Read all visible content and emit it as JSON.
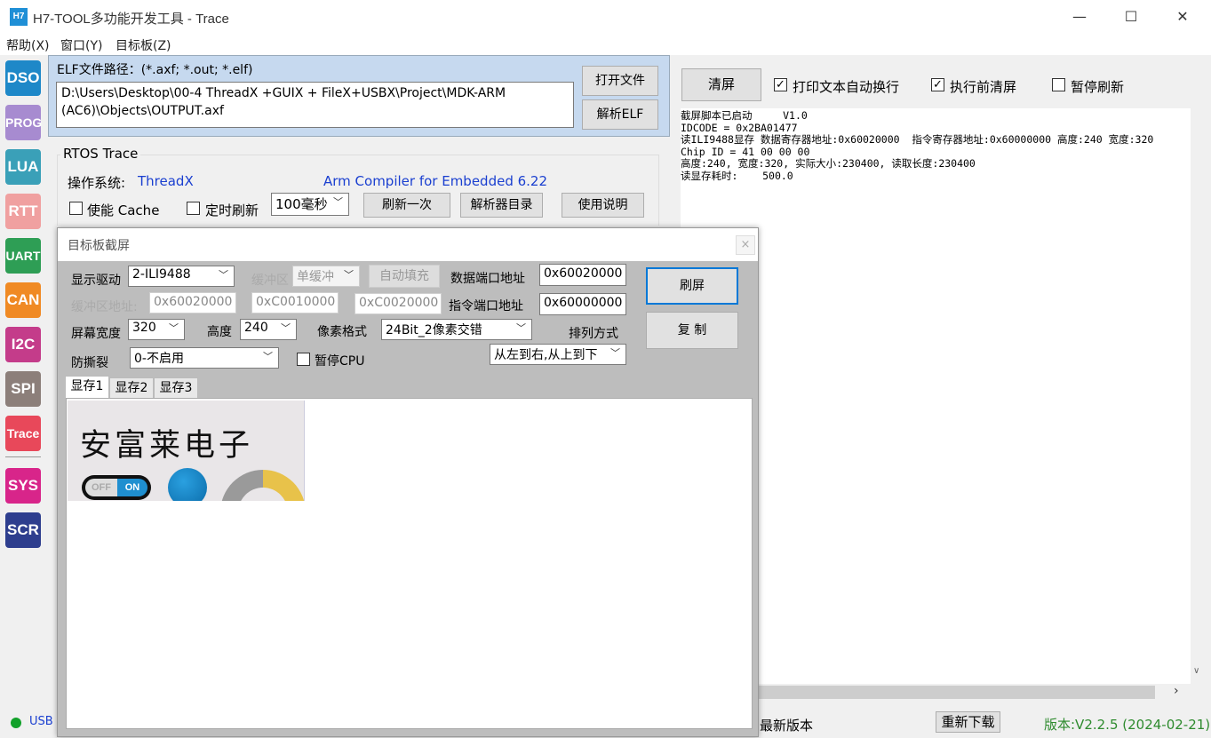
{
  "window": {
    "icon_text": "H7",
    "title": "H7-TOOL多功能开发工具 - Trace",
    "minimize": "—",
    "maximize": "☐",
    "close": "✕"
  },
  "menu": [
    "帮助(X)",
    "窗口(Y)",
    "目标板(Z)"
  ],
  "sidebar": [
    {
      "label": "DSO",
      "color": "#1e88c8"
    },
    {
      "label": "PROG",
      "color": "#a78bd0"
    },
    {
      "label": "LUA",
      "color": "#3aa0b8"
    },
    {
      "label": "RTT",
      "color": "#f0a0a0"
    },
    {
      "label": "UART",
      "color": "#2e9e55"
    },
    {
      "label": "CAN",
      "color": "#f08a24"
    },
    {
      "label": "I2C",
      "color": "#c43c8a"
    },
    {
      "label": "SPI",
      "color": "#8c7f7a"
    },
    {
      "label": "Trace",
      "color": "#e8485a"
    },
    {
      "label": "SYS",
      "color": "#d8258a"
    },
    {
      "label": "SCR",
      "color": "#2e3e8e"
    }
  ],
  "elf": {
    "label": "ELF文件路径：(*.axf; *.out; *.elf)",
    "path_line1": "D:\\Users\\Desktop\\00-4 ThreadX +GUIX + FileX+USBX\\Project\\MDK-ARM",
    "path_line2": "(AC6)\\Objects\\OUTPUT.axf",
    "open_button": "打开文件",
    "parse_button": "解析ELF"
  },
  "rtos": {
    "group_title": "RTOS Trace",
    "os_label": "操作系统:",
    "os_value": "ThreadX",
    "compiler": "Arm Compiler for Embedded 6.22",
    "cache_label": "使能 Cache",
    "timer_label": "定时刷新",
    "interval": "100毫秒",
    "refresh_once": "刷新一次",
    "parser_dir": "解析器目录",
    "help": "使用说明"
  },
  "right": {
    "clear_button": "清屏",
    "wrap_label": "打印文本自动换行",
    "clear_before_label": "执行前清屏",
    "pause_label": "暂停刷新",
    "log_lines": [
      "截屏脚本已启动     V1.0",
      "IDCODE = 0x2BA01477",
      "读ILI9488显存 数据寄存器地址:0x60020000  指令寄存器地址:0x60000000 高度:240 宽度:320",
      "Chip ID = 41 00 00 00",
      "高度:240, 宽度:320, 实际大小:230400, 读取长度:230400",
      "读显存耗时:    500.0"
    ]
  },
  "dialog": {
    "title": "目标板截屏",
    "close": "×",
    "driver_label": "显示驱动",
    "driver_value": "2-ILI9488",
    "buffer_label": "缓冲区",
    "buffer_value": "单缓冲",
    "autofill_button": "自动填充",
    "data_port_label": "数据端口地址",
    "data_port_value": "0x60020000",
    "buffer_addr_label": "缓冲区地址:",
    "buffer_addr1": "0x60020000",
    "buffer_addr2": "0xC0010000",
    "buffer_addr3": "0xC0020000",
    "cmd_port_label": "指令端口地址",
    "cmd_port_value": "0x60000000",
    "width_label": "屏幕宽度",
    "width_value": "320",
    "height_label": "高度",
    "height_value": "240",
    "pixel_label": "像素格式",
    "pixel_value": "24Bit_2像素交错",
    "order_label": "排列方式",
    "order_value": "从左到右,从上到下",
    "tear_label": "防撕裂",
    "tear_value": "0-不启用",
    "pause_cpu_label": "暂停CPU",
    "refresh_button": "刷屏",
    "copy_button": "复 制",
    "tabs": [
      "显存1",
      "显存2",
      "显存3"
    ],
    "preview_text": "安富莱电子",
    "toggle_off": "OFF",
    "toggle_on": "ON"
  },
  "status": {
    "usb_text": "USB",
    "latest": "最新版本",
    "redownload": "重新下载",
    "version": "版本:V2.2.5 (2024-02-21)"
  }
}
